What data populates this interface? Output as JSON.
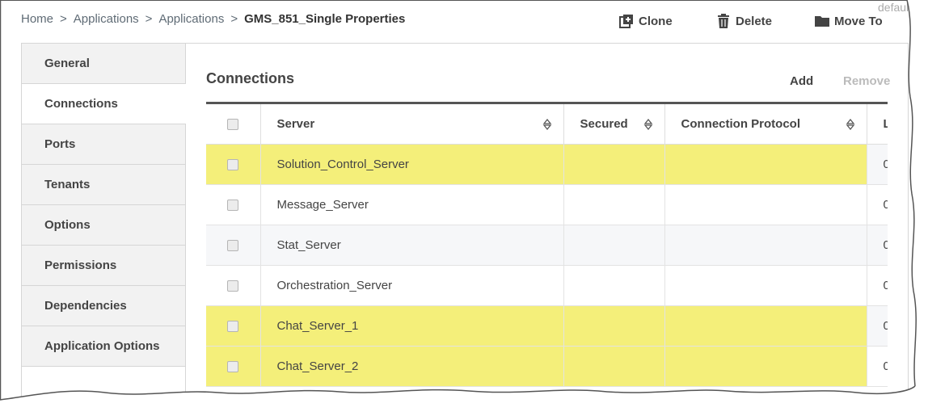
{
  "breadcrumb": {
    "items": [
      "Home",
      "Applications",
      "Applications"
    ],
    "current": "GMS_851_Single Properties",
    "separator": ">"
  },
  "toolbar": {
    "clone_label": "Clone",
    "delete_label": "Delete",
    "move_label": "Move To",
    "user_label": "default"
  },
  "tabs": [
    {
      "label": "General",
      "active": false
    },
    {
      "label": "Connections",
      "active": true
    },
    {
      "label": "Ports",
      "active": false
    },
    {
      "label": "Tenants",
      "active": false
    },
    {
      "label": "Options",
      "active": false
    },
    {
      "label": "Permissions",
      "active": false
    },
    {
      "label": "Dependencies",
      "active": false
    },
    {
      "label": "Application Options",
      "active": false
    }
  ],
  "connections": {
    "title": "Connections",
    "add_label": "Add",
    "remove_label": "Remove",
    "columns": [
      "Server",
      "Secured",
      "Connection Protocol",
      "L"
    ],
    "rows": [
      {
        "server": "Solution_Control_Server",
        "secured": "",
        "protocol": "",
        "edge": "0",
        "highlighted": true
      },
      {
        "server": "Message_Server",
        "secured": "",
        "protocol": "",
        "edge": "0",
        "highlighted": false
      },
      {
        "server": "Stat_Server",
        "secured": "",
        "protocol": "",
        "edge": "0",
        "highlighted": false
      },
      {
        "server": "Orchestration_Server",
        "secured": "",
        "protocol": "",
        "edge": "0",
        "highlighted": false
      },
      {
        "server": "Chat_Server_1",
        "secured": "",
        "protocol": "",
        "edge": "0",
        "highlighted": true
      },
      {
        "server": "Chat_Server_2",
        "secured": "",
        "protocol": "",
        "edge": "0",
        "highlighted": true
      }
    ]
  },
  "colors": {
    "highlight": "#f4ef7a",
    "header_rule": "#555555",
    "tab_bg": "#f2f2f2",
    "disabled_text": "#bbbbbb"
  }
}
